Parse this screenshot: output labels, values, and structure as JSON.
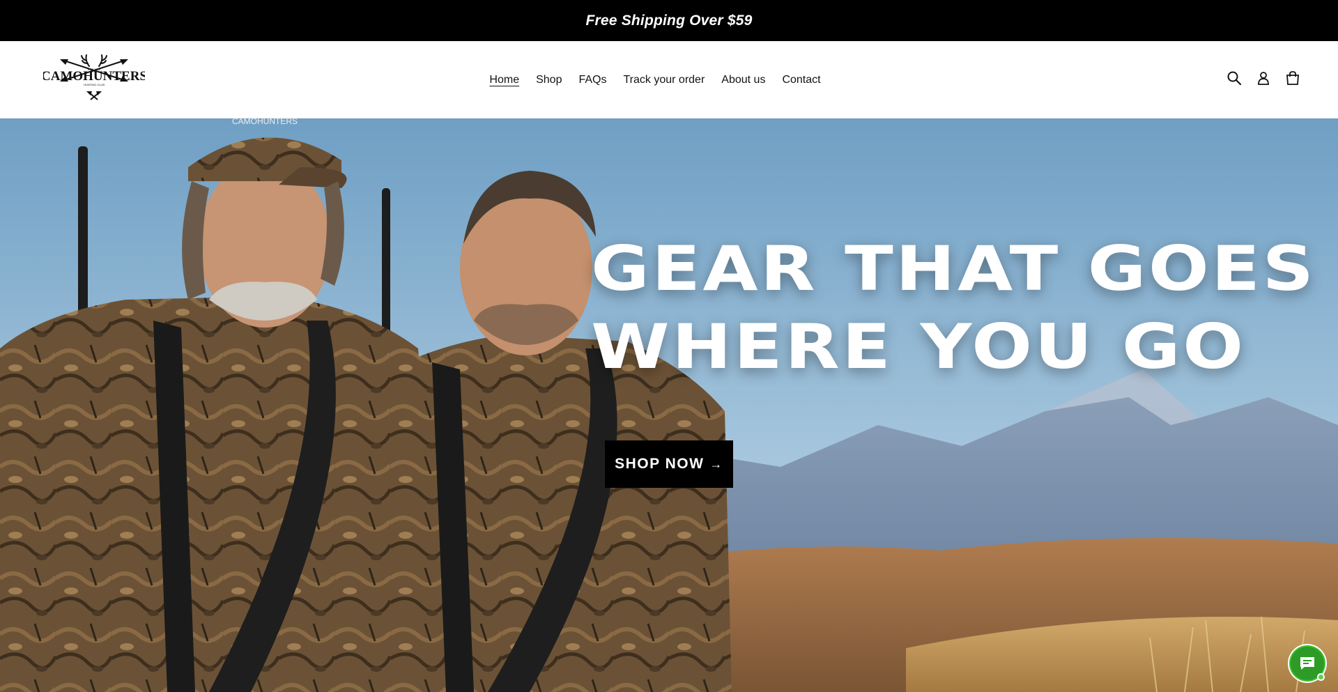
{
  "announcement": {
    "text": "Free Shipping Over $59"
  },
  "logo": {
    "name": "CAMOHUNTERS",
    "est": "EST. 2000",
    "tagline": "HUNTING CLUB"
  },
  "nav": {
    "items": [
      {
        "label": "Home",
        "active": true
      },
      {
        "label": "Shop",
        "active": false
      },
      {
        "label": "FAQs",
        "active": false
      },
      {
        "label": "Track your order",
        "active": false
      },
      {
        "label": "About us",
        "active": false
      },
      {
        "label": "Contact",
        "active": false
      }
    ]
  },
  "header_icons": [
    "search-icon",
    "account-icon",
    "cart-icon"
  ],
  "hero": {
    "headline_line1": "GEAR THAT GOES",
    "headline_line2": "WHERE YOU GO",
    "cta_label": "SHOP NOW",
    "cta_arrow": "→",
    "cap_text": "CAMOHUNTERS"
  },
  "chat": {
    "icon": "chat-bubble-icon",
    "accent": "#2e9b26",
    "status": "online"
  },
  "colors": {
    "announcement_bg": "#000000",
    "cta_bg": "#000000",
    "sky": "#7aa6c8",
    "camo": "#6b5236"
  }
}
